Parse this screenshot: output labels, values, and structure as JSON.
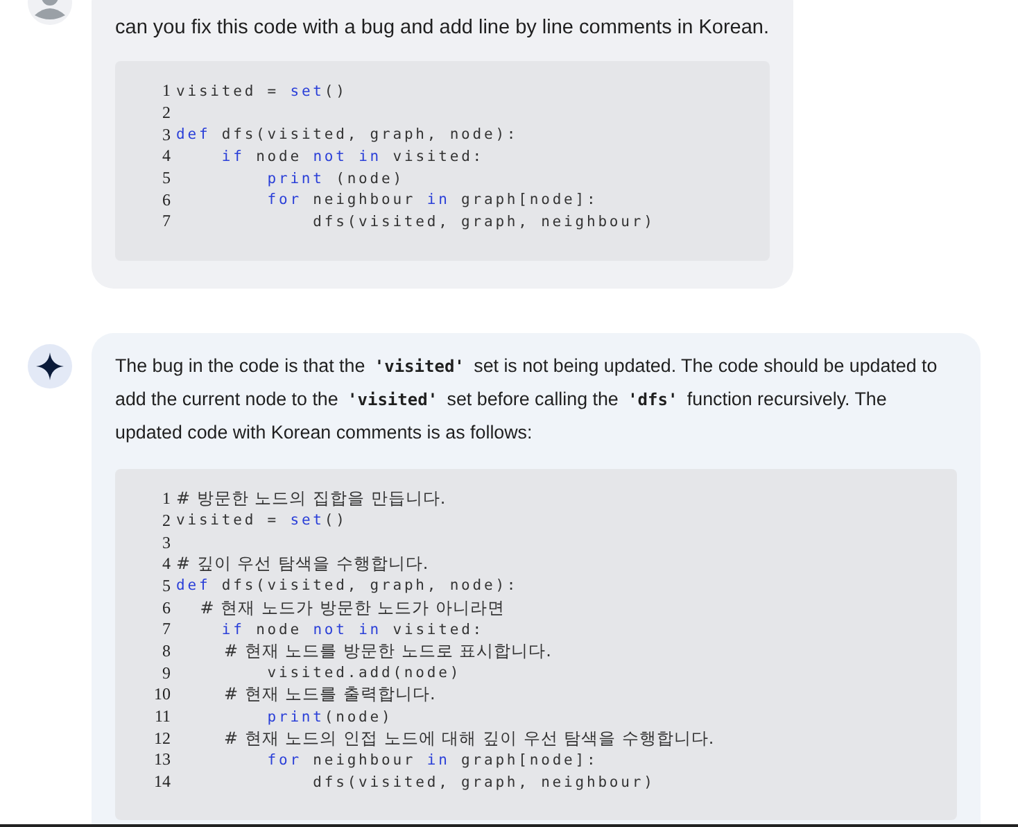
{
  "messages": [
    {
      "kind": "user",
      "text": "can you fix this code with a bug and add line by line comments in Korean.",
      "code": [
        {
          "number": "1",
          "tokens": [
            {
              "kind": "plain",
              "text": "visited = "
            },
            {
              "kind": "keyword",
              "text": "set"
            },
            {
              "kind": "plain",
              "text": "()"
            }
          ]
        },
        {
          "number": "2"
        },
        {
          "number": "3",
          "tokens": [
            {
              "kind": "keyword",
              "text": "def"
            },
            {
              "kind": "plain",
              "text": " dfs(visited, graph, node):"
            }
          ]
        },
        {
          "number": "4",
          "tokens": [
            {
              "kind": "keyword",
              "text": "    if"
            },
            {
              "kind": "plain",
              "text": " node "
            },
            {
              "kind": "keyword",
              "text": "not in"
            },
            {
              "kind": "plain",
              "text": " visited:"
            }
          ]
        },
        {
          "number": "5",
          "tokens": [
            {
              "kind": "keyword",
              "text": "        print"
            },
            {
              "kind": "plain",
              "text": " (node)"
            }
          ]
        },
        {
          "number": "6",
          "tokens": [
            {
              "kind": "keyword",
              "text": "        for"
            },
            {
              "kind": "plain",
              "text": " neighbour "
            },
            {
              "kind": "keyword",
              "text": "in"
            },
            {
              "kind": "plain",
              "text": " graph[node]:"
            }
          ]
        },
        {
          "number": "7",
          "tokens": [
            {
              "kind": "plain",
              "text": "            dfs(visited, graph, neighbour)"
            }
          ]
        }
      ]
    },
    {
      "kind": "assistant",
      "parts": [
        {
          "kind": "text",
          "text": "The bug in the code is that the "
        },
        {
          "kind": "code",
          "text": "'visited'"
        },
        {
          "kind": "text",
          "text": " set is not being updated. The code should be updated to add the current node to the "
        },
        {
          "kind": "code",
          "text": "'visited'"
        },
        {
          "kind": "text",
          "text": " set before calling the "
        },
        {
          "kind": "code",
          "text": "'dfs'"
        },
        {
          "kind": "text",
          "text": " function recursively. The updated code with Korean comments is as follows:"
        }
      ],
      "code": [
        {
          "number": "1",
          "tokens": [
            {
              "kind": "comment",
              "text": "# 방문한 노드의 집합을 만듭니다."
            }
          ]
        },
        {
          "number": "2",
          "tokens": [
            {
              "kind": "plain",
              "text": "visited = "
            },
            {
              "kind": "keyword",
              "text": "set"
            },
            {
              "kind": "plain",
              "text": "()"
            }
          ]
        },
        {
          "number": "3"
        },
        {
          "number": "4",
          "tokens": [
            {
              "kind": "comment",
              "text": "# 깊이 우선 탐색을 수행합니다."
            }
          ]
        },
        {
          "number": "5",
          "tokens": [
            {
              "kind": "keyword",
              "text": "def"
            },
            {
              "kind": "plain",
              "text": " dfs(visited, graph, node):"
            }
          ]
        },
        {
          "number": "6",
          "tokens": [
            {
              "kind": "comment",
              "text": "    # 현재 노드가 방문한 노드가 아니라면"
            }
          ]
        },
        {
          "number": "7",
          "tokens": [
            {
              "kind": "keyword",
              "text": "    if"
            },
            {
              "kind": "plain",
              "text": " node "
            },
            {
              "kind": "keyword",
              "text": "not in"
            },
            {
              "kind": "plain",
              "text": " visited:"
            }
          ]
        },
        {
          "number": "8",
          "tokens": [
            {
              "kind": "comment",
              "text": "        # 현재 노드를 방문한 노드로 표시합니다."
            }
          ]
        },
        {
          "number": "9",
          "tokens": [
            {
              "kind": "plain",
              "text": "        visited.add(node)"
            }
          ]
        },
        {
          "number": "10",
          "tokens": [
            {
              "kind": "comment",
              "text": "        # 현재 노드를 출력합니다."
            }
          ]
        },
        {
          "number": "11",
          "tokens": [
            {
              "kind": "keyword",
              "text": "        print"
            },
            {
              "kind": "plain",
              "text": "(node)"
            }
          ]
        },
        {
          "number": "12",
          "tokens": [
            {
              "kind": "comment",
              "text": "        # 현재 노드의 인접 노드에 대해 깊이 우선 탐색을 수행합니다."
            }
          ]
        },
        {
          "number": "13",
          "tokens": [
            {
              "kind": "keyword",
              "text": "        for"
            },
            {
              "kind": "plain",
              "text": " neighbour "
            },
            {
              "kind": "keyword",
              "text": "in"
            },
            {
              "kind": "plain",
              "text": " graph[node]:"
            }
          ]
        },
        {
          "number": "14",
          "tokens": [
            {
              "kind": "plain",
              "text": "            dfs(visited, graph, neighbour)"
            }
          ]
        }
      ]
    }
  ]
}
